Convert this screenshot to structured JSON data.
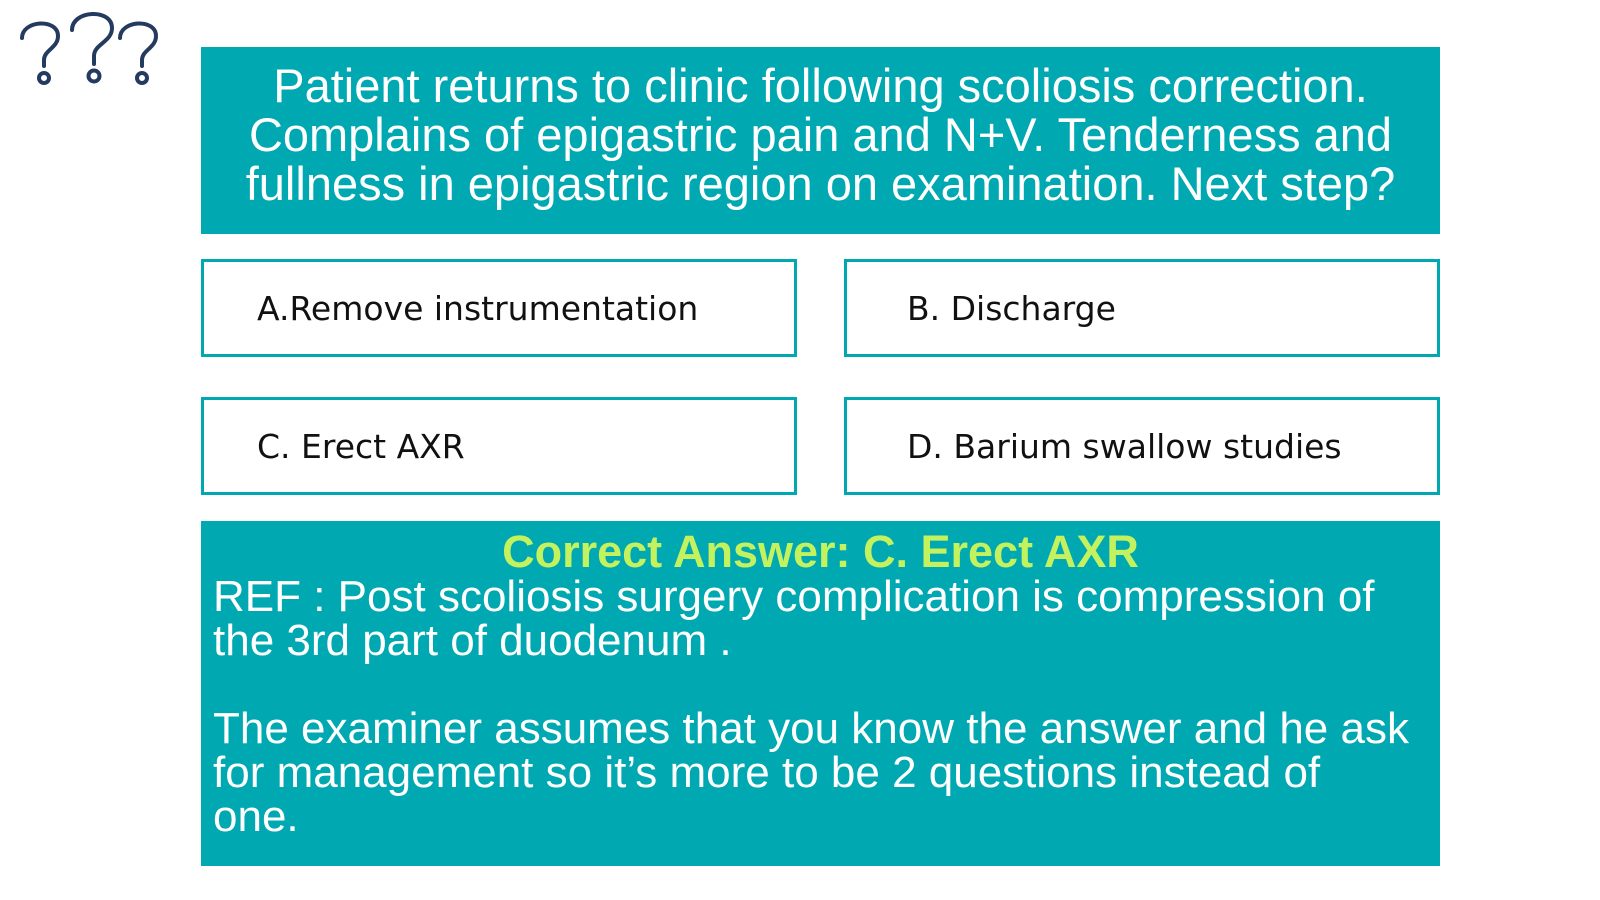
{
  "colors": {
    "accent": "#00a8b2",
    "answer_title": "#c4f25e",
    "question_mark_icon": "#243a5e"
  },
  "decoration": {
    "icon": "question-marks-icon"
  },
  "question": {
    "lines": [
      "Patient returns to clinic following scoliosis correction.",
      "Complains of epigastric pain and N+V. Tenderness and",
      "fullness in epigastric region on examination. Next step?"
    ]
  },
  "options": {
    "a": "A.Remove instrumentation",
    "b": "B. Discharge",
    "c": "C. Erect AXR",
    "d": "D. Barium swallow studies"
  },
  "answer": {
    "title": "Correct Answer: C. Erect AXR",
    "ref_lines": [
      "REF : Post scoliosis surgery complication is compression of",
      "the 3rd part of duodenum ."
    ],
    "note_lines": [
      "The examiner assumes that you know the answer and he ask",
      "for management so it’s more to be 2 questions instead of",
      "one."
    ]
  }
}
